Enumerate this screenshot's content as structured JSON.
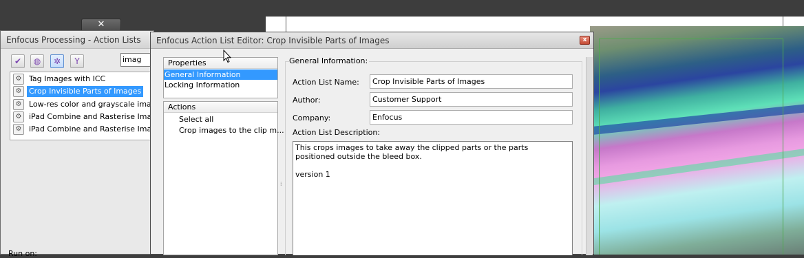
{
  "back_window": {
    "title": "Enfocus Processing - Action Lists",
    "close_glyph": "✕",
    "toolbar": {
      "check_icon": "check-icon",
      "globe_icon": "globe-icon",
      "gear_icon": "gear-icon",
      "filter_icon": "funnel-icon"
    },
    "search_value": "imag",
    "items": [
      {
        "label": "Tag Images with ICC",
        "selected": false
      },
      {
        "label": "Crop Invisible Parts of Images",
        "selected": true
      },
      {
        "label": "Low-res color and grayscale images:",
        "selected": false
      },
      {
        "label": "iPad Combine and Rasterise Images",
        "selected": false
      },
      {
        "label": "iPad Combine and Rasterise Images t",
        "selected": false
      }
    ],
    "run_on_label": "Run on:"
  },
  "front_window": {
    "title": "Enfocus Action List Editor: Crop Invisible Parts of Images",
    "close_glyph": "x",
    "properties": {
      "header": "Properties",
      "items": [
        "General Information",
        "Locking Information"
      ],
      "selected_index": 0
    },
    "actions": {
      "header": "Actions",
      "items": [
        "Select all",
        "Crop images to the clip m..."
      ]
    },
    "general": {
      "group_title": "General Information:",
      "name_label": "Action List Name:",
      "name_value": "Crop Invisible Parts of Images",
      "author_label": "Author:",
      "author_value": "Customer Support",
      "company_label": "Company:",
      "company_value": "Enfocus",
      "description_label": "Action List Description:",
      "description_value": "This crops images to take away the clipped parts or the parts positioned outside the bleed box.\n\nversion 1"
    }
  },
  "colors": {
    "selection": "#3399ff",
    "title_text": "#333333"
  }
}
